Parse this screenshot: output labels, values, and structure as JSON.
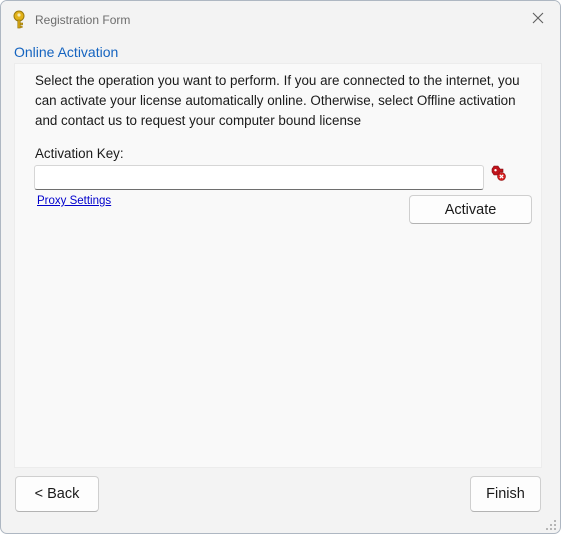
{
  "window": {
    "title": "Registration Form",
    "icon": "key-icon",
    "close_icon": "close-icon"
  },
  "section": {
    "title": "Online Activation"
  },
  "content": {
    "description": "Select the operation you want to perform. If you are connected to the internet, you can activate your license automatically online. Otherwise, select Offline activation and contact us to request your computer bound license",
    "activation_key_label": "Activation Key:",
    "activation_key_value": "",
    "activation_key_error_icon": "error-icon",
    "proxy_settings_label": "Proxy Settings",
    "activate_label": "Activate"
  },
  "footer": {
    "back_label": "< Back",
    "finish_label": "Finish"
  },
  "colors": {
    "section_title": "#1564c0",
    "link": "#0000cc",
    "error": "#c0141c"
  }
}
